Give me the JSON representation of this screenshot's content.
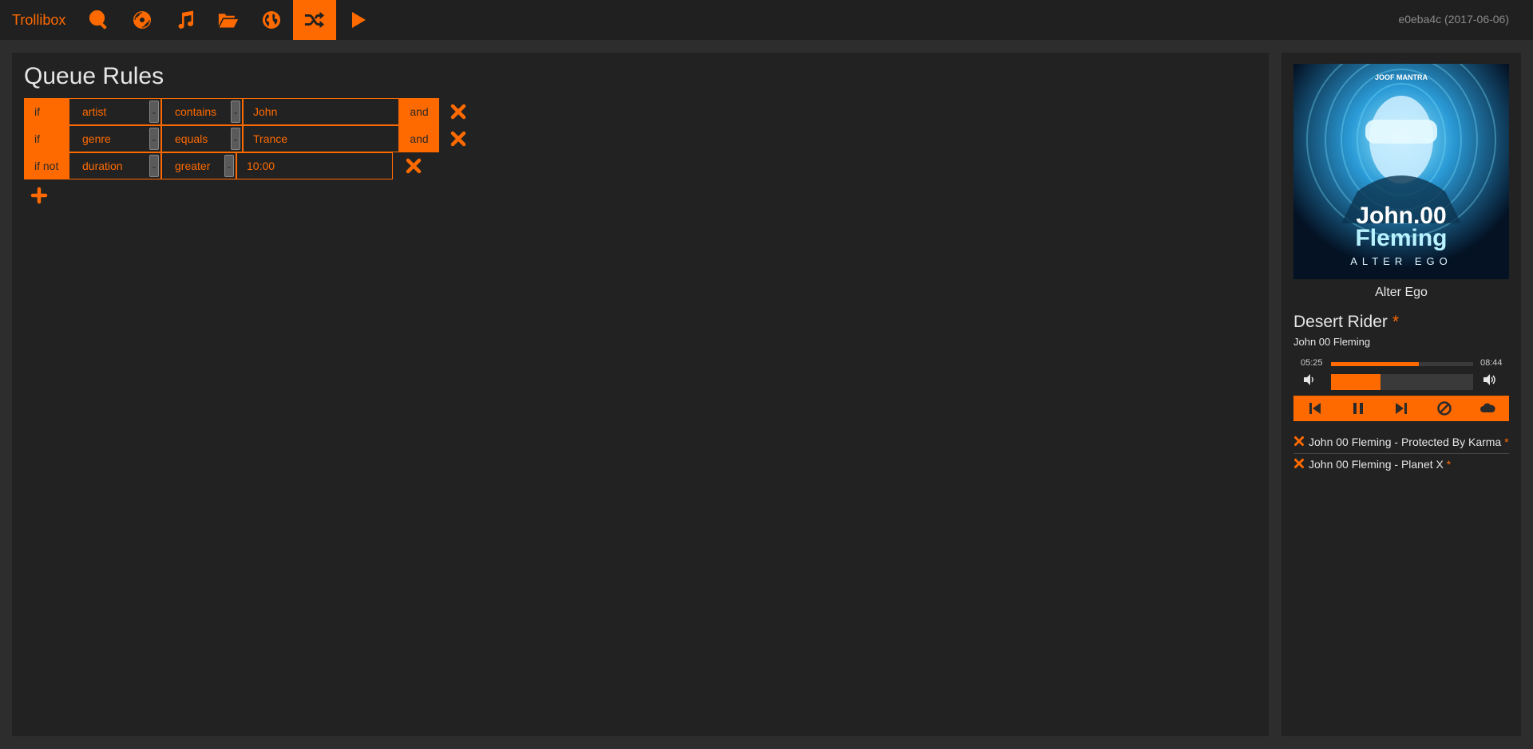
{
  "app": {
    "name": "Trollibox",
    "version": "e0eba4c (2017-06-06)",
    "accent_color": "#ff6a00"
  },
  "nav": [
    {
      "icon": "search-icon",
      "active": false
    },
    {
      "icon": "record-icon",
      "active": false
    },
    {
      "icon": "music-note-icon",
      "active": false
    },
    {
      "icon": "folder-open-icon",
      "active": false
    },
    {
      "icon": "globe-icon",
      "active": false
    },
    {
      "icon": "shuffle-icon",
      "active": true
    },
    {
      "icon": "play-icon",
      "active": false
    }
  ],
  "queue_rules": {
    "title": "Queue Rules",
    "rules": [
      {
        "condition": "if",
        "attribute": "artist",
        "operation": "contains",
        "value": "John",
        "join": "and"
      },
      {
        "condition": "if",
        "attribute": "genre",
        "operation": "equals",
        "value": "Trance",
        "join": "and"
      },
      {
        "condition": "if not",
        "attribute": "duration",
        "operation": "greater",
        "value": "10:00",
        "join": ""
      }
    ],
    "add_icon": "plus-icon",
    "remove_icon": "close-icon"
  },
  "player": {
    "album": "Alter Ego",
    "cover_text": {
      "label": "JOOF MANTRA",
      "artist_line1": "John.00",
      "artist_line2": "Fleming",
      "album": "ALTER EGO"
    },
    "track": {
      "title": "Desert Rider",
      "starred": "*",
      "artist": "John 00 Fleming"
    },
    "time_elapsed": "05:25",
    "time_total": "08:44",
    "progress_fraction": 0.62,
    "volume_fraction": 0.35,
    "controls": [
      "previous-icon",
      "pause-icon",
      "next-icon",
      "block-icon",
      "cloud-icon"
    ]
  },
  "queue": [
    {
      "text": "John 00 Fleming - Protected By Karma",
      "star": "*"
    },
    {
      "text": "John 00 Fleming - Planet X",
      "star": "*"
    }
  ]
}
